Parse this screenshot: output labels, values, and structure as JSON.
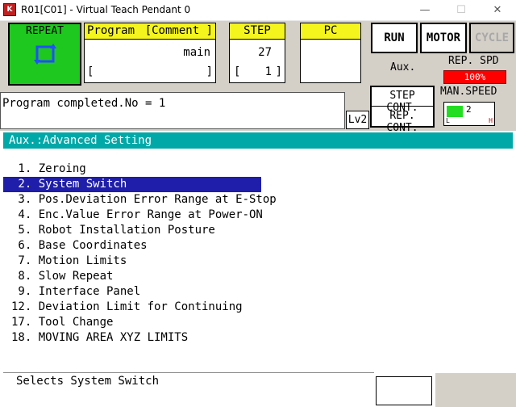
{
  "window": {
    "icon_text": "K",
    "title": "R01[C01] - Virtual Teach Pendant 0",
    "minimize": "—",
    "maximize": "☐",
    "close": "✕"
  },
  "mode": {
    "label": "REPEAT",
    "color": "#1ec81e"
  },
  "program": {
    "header": "Program",
    "comment_header": "[Comment ]",
    "name": "main",
    "comment_open": "[",
    "comment_close": "]"
  },
  "step": {
    "header": "STEP",
    "value": "27",
    "sub_open": "[",
    "sub_value": "1",
    "sub_close": "]"
  },
  "pc": {
    "header": "PC"
  },
  "buttons": {
    "run": "RUN",
    "motor": "MOTOR",
    "cycle": "CYCLE",
    "aux": "Aux.",
    "step_cont": "STEP CONT.",
    "rep_cont": "REP. CONT.",
    "lv": "Lv2"
  },
  "rep_speed": {
    "label": "REP. SPD",
    "value": "100%",
    "fraction": 1.0
  },
  "man_speed": {
    "label": "MAN.SPEED",
    "value": "2",
    "low": "L",
    "high": "H",
    "level": 2
  },
  "message": "Program completed.No = 1",
  "section_title": "Aux.:Advanced Setting",
  "menu": {
    "items": [
      {
        "label": " 1. Zeroing",
        "selected": false
      },
      {
        "label": " 2. System Switch",
        "selected": true
      },
      {
        "label": " 3. Pos.Deviation Error Range at E-Stop",
        "selected": false
      },
      {
        "label": " 4. Enc.Value Error Range at Power-ON",
        "selected": false
      },
      {
        "label": " 5. Robot Installation Posture",
        "selected": false
      },
      {
        "label": " 6. Base Coordinates",
        "selected": false
      },
      {
        "label": " 7. Motion Limits",
        "selected": false
      },
      {
        "label": " 8. Slow Repeat",
        "selected": false
      },
      {
        "label": " 9. Interface Panel",
        "selected": false
      },
      {
        "label": "12. Deviation Limit for Continuing",
        "selected": false
      },
      {
        "label": "17. Tool Change",
        "selected": false
      },
      {
        "label": "18. MOVING AREA XYZ LIMITS",
        "selected": false
      }
    ]
  },
  "hint": "Selects System Switch",
  "colors": {
    "accent_yellow": "#f5f51e",
    "section_teal": "#00a8a8",
    "selection_blue": "#1e1eaa",
    "speed_red": "#ff0000"
  }
}
